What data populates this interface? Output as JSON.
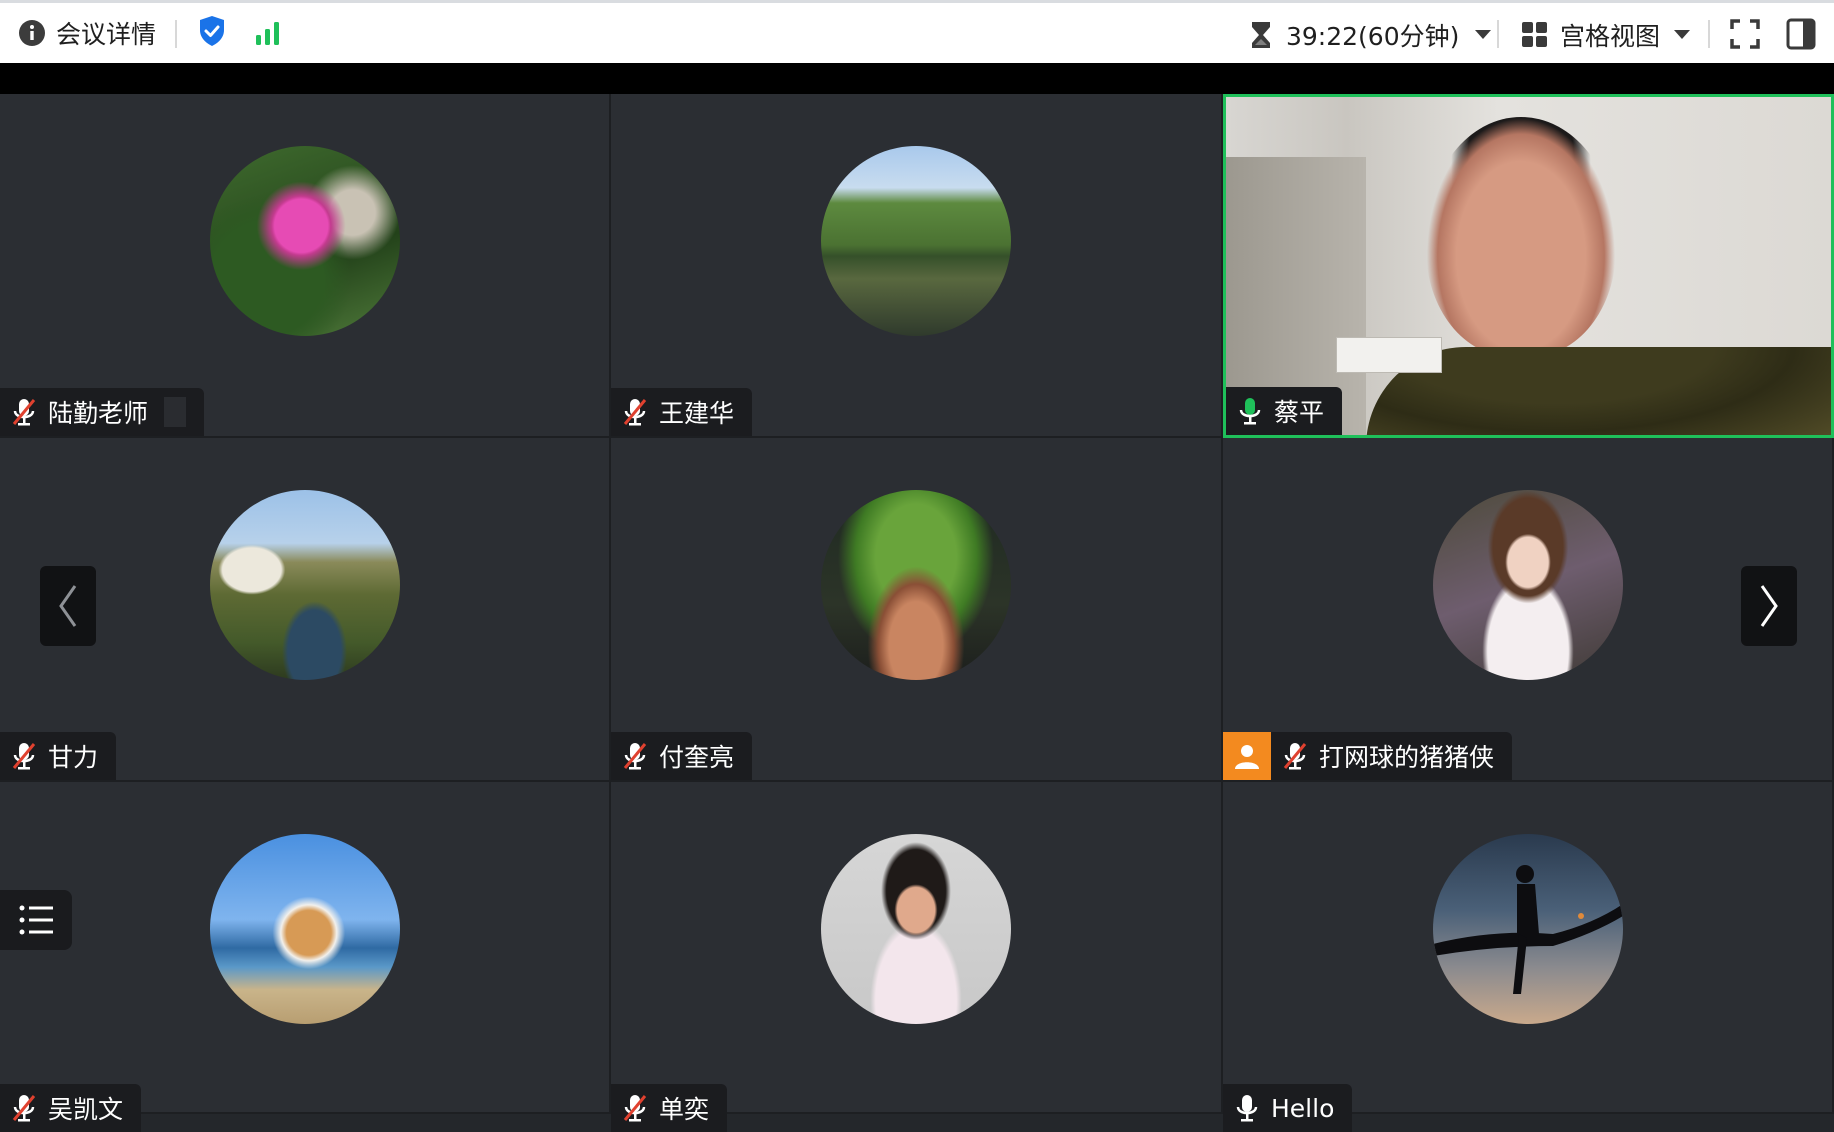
{
  "topbar": {
    "meeting_details": "会议详情",
    "timer": "39:22(60分钟)",
    "view_mode": "宫格视图"
  },
  "participants": [
    {
      "name": "陆勤老师",
      "mic": "muted",
      "avatar": "pink-flower-avatar"
    },
    {
      "name": "王建华",
      "mic": "muted",
      "avatar": "lake-trees-avatar"
    },
    {
      "name": "蔡平",
      "mic": "active",
      "video": true,
      "active_speaker": true
    },
    {
      "name": "甘力",
      "mic": "muted",
      "avatar": "cottage-stream-avatar"
    },
    {
      "name": "付奎亮",
      "mic": "muted",
      "avatar": "potted-plant-avatar"
    },
    {
      "name": "打网球的猪猪侠",
      "mic": "muted",
      "host": true,
      "avatar": "girl-with-flowers-avatar"
    },
    {
      "name": "吴凯文",
      "mic": "muted",
      "avatar": "corgi-beach-avatar"
    },
    {
      "name": "单奕",
      "mic": "muted",
      "avatar": "smiling-girl-avatar"
    },
    {
      "name": "Hello",
      "mic": "on",
      "avatar": "silhouette-on-branch-avatar"
    }
  ],
  "colors": {
    "active_speaker_border": "#1fc05a",
    "host_badge": "#f38a1f",
    "muted_slash": "#e0412f",
    "shield": "#1a73e8",
    "signal": "#1fc05a"
  }
}
